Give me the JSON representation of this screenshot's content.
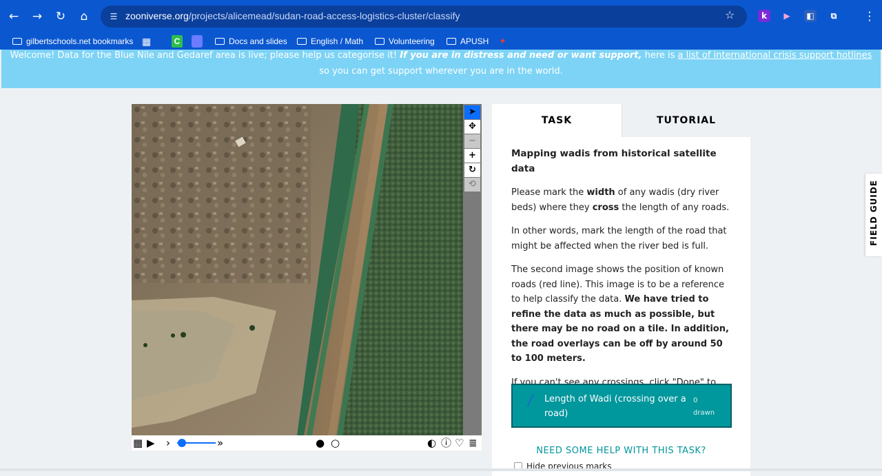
{
  "browser": {
    "url_domain": "zooniverse.org",
    "url_path": "/projects/alicemead/sudan-road-access-logistics-cluster/classify",
    "extensions": [
      "k",
      "▶",
      "◧",
      "⧉"
    ]
  },
  "bookmarks": [
    {
      "label": "gilbertschools.net bookmarks"
    },
    {
      "label": "Docs and slides"
    },
    {
      "label": "English / Math"
    },
    {
      "label": "Volunteering"
    },
    {
      "label": "APUSH"
    }
  ],
  "banner": {
    "text_plain": "Welcome! Data for the Blue Nile and Gedaref area is live; please help us categorise it!",
    "text_bold_italic": "If you are in distress and need or want support,",
    "text_mid": "here is",
    "link": "a list of international crisis support hotlines",
    "text_end": "so you can get support wherever you are in the world."
  },
  "tabs": {
    "task": "TASK",
    "tutorial": "TUTORIAL"
  },
  "task": {
    "title": "Mapping wadis from historical satellite data",
    "p1_a": "Please mark the ",
    "p1_b": "width",
    "p1_c": " of any wadis (dry river beds) where they ",
    "p1_d": "cross",
    "p1_e": " the length of any roads.",
    "p2": "In other words, mark the length of the road that might be affected when the river bed is full.",
    "p3_a": "The second image shows the position of known roads (red line). This image is to be a reference to help classify the data. ",
    "p3_b": "We have tried to refine the data as much as possible, but there may be no road on a tile. In addition, the road overlays can be off by around 50 to 100 meters.",
    "p4": "If you can't see any crossings, click \"Done\" to move on to the next image.",
    "tool_label": "Length of Wadi (crossing over a road)",
    "tool_count": "0",
    "tool_count_suffix": "drawn",
    "help": "NEED SOME HELP WITH THIS TASK?",
    "hide_previous": "Hide previous marks"
  },
  "field_guide": "FIELD GUIDE",
  "colors": {
    "chrome_blue": "#0b57d0",
    "banner": "#7dd3f5",
    "teal": "#00979d"
  }
}
